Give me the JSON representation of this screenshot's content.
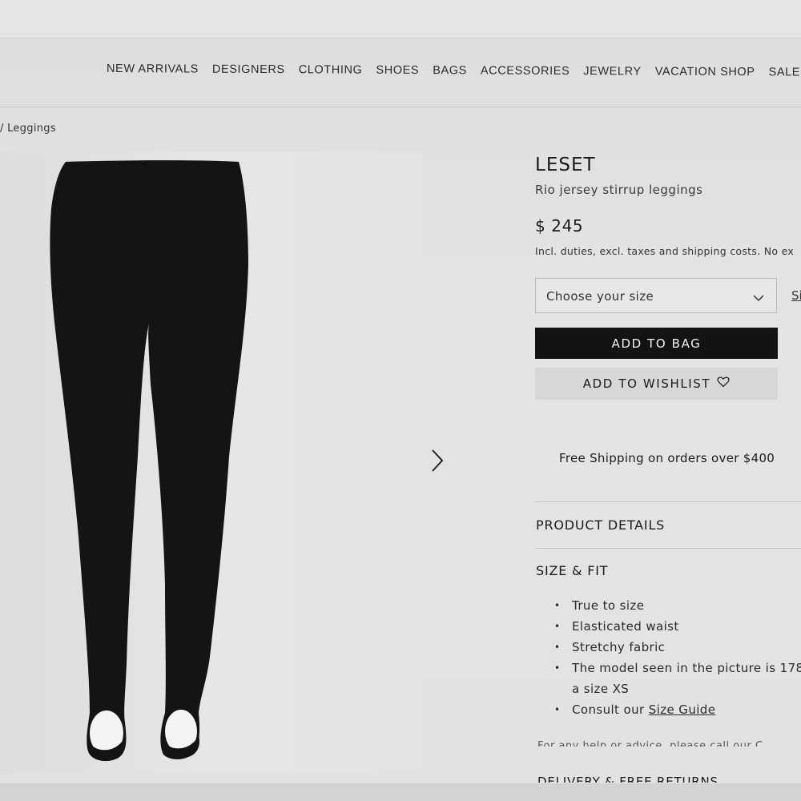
{
  "nav": {
    "items": [
      "NEW ARRIVALS",
      "DESIGNERS",
      "CLOTHING",
      "SHOES",
      "BAGS",
      "ACCESSORIES",
      "JEWELRY",
      "VACATION SHOP",
      "SALE"
    ]
  },
  "breadcrumb": {
    "text": "/ Leggings"
  },
  "product": {
    "brand": "LESET",
    "name": "Rio jersey stirrup leggings",
    "price": "$ 245",
    "duties_note": "Incl. duties, excl. taxes and shipping costs. No ex",
    "size_placeholder": "Choose your size",
    "size_guide_link": "Si",
    "add_to_bag": "ADD TO BAG",
    "add_to_wishlist": "ADD TO WISHLIST"
  },
  "shipping": {
    "text": "Free Shipping on orders over $400"
  },
  "sections": {
    "product_details": "PRODUCT DETAILS",
    "size_fit": "SIZE & FIT",
    "size_fit_bullets": [
      "True to size",
      "Elasticated waist",
      "Stretchy fabric",
      "The model seen in the picture is 178",
      "a size XS"
    ],
    "consult_prefix": "Consult our",
    "consult_link": "Size Guide",
    "help_text_cut": "For any help or advice, please call our C",
    "delivery_heading_cut": "DELIVERY & FREE RETURNS"
  },
  "icons": {
    "next": "chevron-right-icon",
    "dropdown": "chevron-down-icon",
    "wishlist": "heart-icon"
  }
}
